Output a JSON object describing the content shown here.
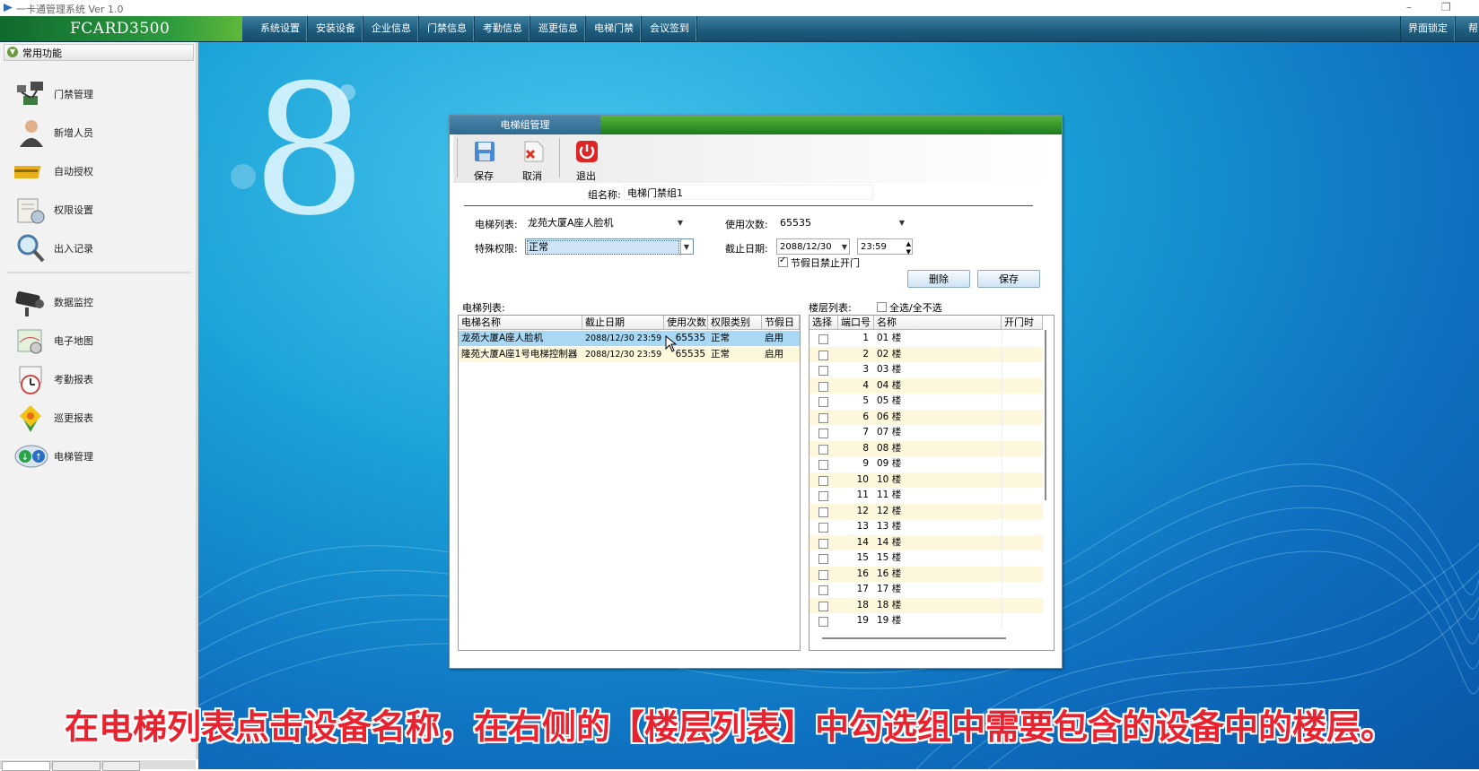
{
  "window": {
    "title": "一卡通管理系统  Ver 1.0"
  },
  "brand": "FCARD3500",
  "menu": [
    "系统设置",
    "安装设备",
    "企业信息",
    "门禁信息",
    "考勤信息",
    "巡更信息",
    "电梯门禁",
    "会议签到"
  ],
  "menu_right": [
    "界面锁定",
    "帮"
  ],
  "sidebar": {
    "header": "常用功能",
    "items": [
      {
        "label": "门禁管理",
        "icon": "door-access-icon"
      },
      {
        "label": "新增人员",
        "icon": "person-icon"
      },
      {
        "label": "自动授权",
        "icon": "card-icon"
      },
      {
        "label": "权限设置",
        "icon": "permission-icon"
      },
      {
        "label": "出入记录",
        "icon": "magnifier-icon"
      },
      {
        "label": "数据监控",
        "icon": "camera-icon"
      },
      {
        "label": "电子地图",
        "icon": "map-icon"
      },
      {
        "label": "考勤报表",
        "icon": "clock-icon"
      },
      {
        "label": "巡更报表",
        "icon": "patrol-icon"
      },
      {
        "label": "电梯管理",
        "icon": "elevator-icon"
      }
    ]
  },
  "dialog": {
    "title": "电梯组管理",
    "toolbar": {
      "save": "保存",
      "cancel": "取消",
      "exit": "退出"
    },
    "group_name_label": "组名称:",
    "group_name_value": "电梯门禁组1",
    "elevator_list_label": "电梯列表:",
    "elevator_list_value": "龙苑大厦A座人脸机",
    "use_count_label": "使用次数:",
    "use_count_value": "65535",
    "special_perm_label": "特殊权限:",
    "special_perm_value": "正常",
    "deadline_label": "截止日期:",
    "deadline_date": "2088/12/30",
    "deadline_time": "23:59",
    "holiday_label": "节假日禁止开门",
    "holiday_checked": true,
    "delete_button": "删除",
    "save_button": "保存",
    "elev_grid": {
      "caption": "电梯列表:",
      "headers": [
        "电梯名称",
        "截止日期",
        "使用次数",
        "权限类别",
        "节假日"
      ],
      "rows": [
        [
          "龙苑大厦A座人脸机",
          "2088/12/30 23:59",
          "65535",
          "正常",
          "启用"
        ],
        [
          "隆苑大厦A座1号电梯控制器",
          "2088/12/30 23:59",
          "65535",
          "正常",
          "启用"
        ]
      ]
    },
    "floor_grid": {
      "caption": "楼层列表:",
      "select_all": "全选/全不选",
      "headers": [
        "选择",
        "端口号",
        "名称",
        "开门时"
      ],
      "rows": [
        [
          "1",
          "01 楼"
        ],
        [
          "2",
          "02 楼"
        ],
        [
          "3",
          "03 楼"
        ],
        [
          "4",
          "04 楼"
        ],
        [
          "5",
          "05 楼"
        ],
        [
          "6",
          "06 楼"
        ],
        [
          "7",
          "07 楼"
        ],
        [
          "8",
          "08 楼"
        ],
        [
          "9",
          "09 楼"
        ],
        [
          "10",
          "10 楼"
        ],
        [
          "11",
          "11 楼"
        ],
        [
          "12",
          "12 楼"
        ],
        [
          "13",
          "13 楼"
        ],
        [
          "14",
          "14 楼"
        ],
        [
          "15",
          "15 楼"
        ],
        [
          "16",
          "16 楼"
        ],
        [
          "17",
          "17 楼"
        ],
        [
          "18",
          "18 楼"
        ],
        [
          "19",
          "19 楼"
        ]
      ]
    }
  },
  "subtitle": "在电梯列表点击设备名称，在右侧的【楼层列表】中勾选组中需要包含的设备中的楼层。",
  "colors": {
    "accent_green": "#2c9a3d",
    "menu_blue": "#1e5d7e",
    "selection": "#a8d8f4",
    "row_alt": "#fdf7dc",
    "subtitle_red": "#e8232f"
  }
}
